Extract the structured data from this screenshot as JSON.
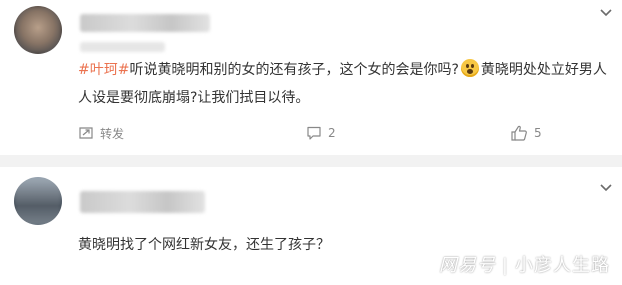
{
  "comments": [
    {
      "hashtag": "#叶珂#",
      "text_part1": "听说黄晓明和别的女的还有孩子，这个女的会是你吗?",
      "text_part2": "黄晓明处处立好男人人设是要彻底崩塌?让我们拭目以待。",
      "emoji": "shocked-face",
      "forward_label": "转发",
      "comment_count": "2",
      "like_count": "5"
    },
    {
      "text": "黄晓明找了个网红新女友，还生了孩子？"
    }
  ],
  "watermark": {
    "brand": "网易号",
    "separator": "|",
    "author": "小彦人生路"
  },
  "colors": {
    "hashtag": "#eb7350",
    "text": "#333333",
    "meta": "#888888",
    "divider": "#f2f2f2"
  }
}
